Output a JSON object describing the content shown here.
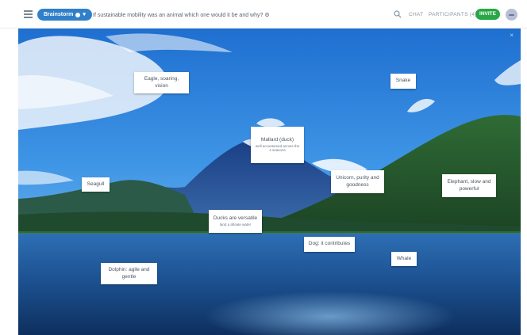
{
  "header": {
    "mode_label": "Brainstorm",
    "question": "If sustainable mobility was an animal which one would it be and why? ⚙",
    "chat_label": "CHAT",
    "participants_label": "PARTICIPANTS (4)",
    "invite_label": "INVITE"
  },
  "colors": {
    "mode_pill": "#2f80c9",
    "invite_button": "#27a745"
  },
  "canvas": {
    "close_glyph": "×"
  },
  "notes": [
    {
      "title": "Eagle, soaring, vision",
      "subtitle": ""
    },
    {
      "title": "Snake",
      "subtitle": ""
    },
    {
      "title": "Mallard (duck)",
      "subtitle": "well accustomed across the 4 seasons"
    },
    {
      "title": "Seagull",
      "subtitle": ""
    },
    {
      "title": "Unicorn, purity and goodness",
      "subtitle": ""
    },
    {
      "title": "Elephant, slow and powerful",
      "subtitle": ""
    },
    {
      "title": "Ducks are versatile",
      "subtitle": "land a afloate water"
    },
    {
      "title": "Dog: it contributes",
      "subtitle": ""
    },
    {
      "title": "Whale",
      "subtitle": ""
    },
    {
      "title": "Dolphin: agile and gentle",
      "subtitle": ""
    }
  ]
}
